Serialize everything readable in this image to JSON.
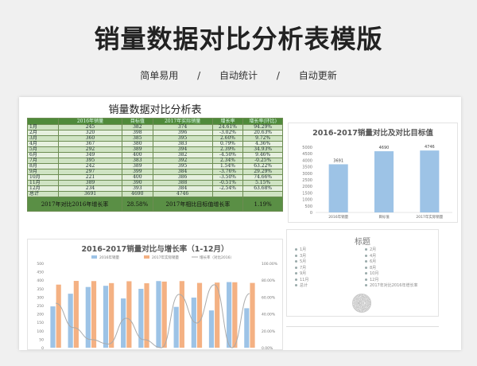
{
  "hero": {
    "title": "销量数据对比分析表模版",
    "features": [
      "简单易用",
      "/",
      "自动统计",
      "/",
      "自动更新"
    ]
  },
  "table": {
    "title": "销量数据对比分析表",
    "headers": [
      "",
      "2016年销量",
      "目标值",
      "2017年实际销量",
      "增长率",
      "增长率(环比)"
    ],
    "rows": [
      [
        "1月",
        "245",
        "382",
        "374",
        "24.61%",
        "94.29%"
      ],
      [
        "2月",
        "320",
        "398",
        "396",
        "-3.02%",
        "20.63%"
      ],
      [
        "3月",
        "360",
        "385",
        "395",
        "2.60%",
        "9.72%"
      ],
      [
        "4月",
        "367",
        "380",
        "383",
        "0.79%",
        "4.36%"
      ],
      [
        "5月",
        "292",
        "389",
        "394",
        "2.39%",
        "34.93%"
      ],
      [
        "6月",
        "349",
        "400",
        "382",
        "-4.50%",
        "9.46%"
      ],
      [
        "7月",
        "395",
        "383",
        "392",
        "2.34%",
        "-0.25%"
      ],
      [
        "8月",
        "242",
        "389",
        "395",
        "1.54%",
        "63.22%"
      ],
      [
        "9月",
        "297",
        "399",
        "384",
        "-3.76%",
        "29.29%"
      ],
      [
        "10月",
        "221",
        "400",
        "386",
        "-3.50%",
        "74.66%"
      ],
      [
        "11月",
        "389",
        "390",
        "388",
        "-0.51%",
        "5.15%"
      ],
      [
        "12月",
        "234",
        "393",
        "384",
        "-2.54%",
        "63.68%"
      ],
      [
        "总计",
        "3691",
        "4690",
        "4746",
        "",
        ""
      ]
    ],
    "summary": [
      "2017年对比2016年增长率",
      "28.58%",
      "2017年相比目标值增长率",
      "1.19%"
    ]
  },
  "chart_data": [
    {
      "type": "bar",
      "title": "2016-2017销量对比及对比目标值",
      "categories": [
        "2016年销量",
        "目标值",
        "2017年实际销量"
      ],
      "values": [
        3691,
        4690,
        4746
      ],
      "ylim": [
        0,
        5000
      ],
      "yticks": [
        "0",
        "500",
        "1000",
        "1500",
        "2000",
        "2500",
        "3000",
        "3500",
        "4000",
        "4500",
        "5000"
      ],
      "color": "#9dc3e6"
    },
    {
      "type": "bar",
      "title": "2016-2017销量对比与增长率（1-12月）",
      "legend": [
        "2016年销量",
        "2017年实际销量",
        "增长率（对比2016）"
      ],
      "categories": [
        "1月",
        "2月",
        "3月",
        "4月",
        "5月",
        "6月",
        "7月",
        "8月",
        "9月",
        "10月",
        "11月",
        "12月"
      ],
      "series": [
        {
          "name": "2016年销量",
          "values": [
            245,
            320,
            360,
            367,
            292,
            349,
            395,
            242,
            297,
            221,
            389,
            234
          ],
          "color": "#9dc3e6"
        },
        {
          "name": "2017年实际销量",
          "values": [
            374,
            396,
            395,
            383,
            394,
            382,
            392,
            395,
            384,
            386,
            388,
            384
          ],
          "color": "#f4b183"
        },
        {
          "name": "增长率（对比2016）",
          "values": [
            52.7,
            23.8,
            9.7,
            4.4,
            34.9,
            9.5,
            -0.8,
            63.2,
            29.3,
            74.7,
            -0.3,
            64.1
          ],
          "color": "#aaaaaa"
        }
      ],
      "yticks_left": [
        "0",
        "50",
        "100",
        "150",
        "200",
        "250",
        "300",
        "350",
        "400",
        "450",
        "500"
      ],
      "yticks_right": [
        "0.00%",
        "20.00%",
        "40.00%",
        "60.00%",
        "80.00%",
        "100.00%"
      ],
      "ylim_left": [
        0,
        500
      ],
      "ylim_right": [
        0,
        100
      ]
    }
  ],
  "pie_panel": {
    "title": "标题",
    "legend": [
      "1月",
      "2月",
      "3月",
      "4月",
      "5月",
      "6月",
      "7月",
      "8月",
      "9月",
      "10月",
      "11月",
      "12月",
      "总计",
      "2017年对比2016年增长率"
    ]
  }
}
